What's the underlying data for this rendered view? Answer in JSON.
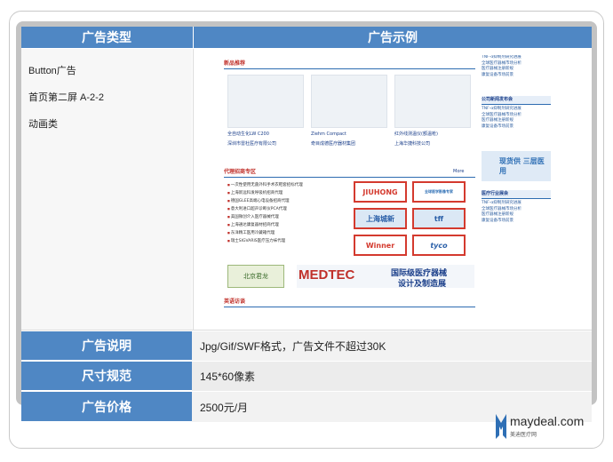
{
  "header": {
    "col1": "广告类型",
    "col2": "广告示例"
  },
  "ad_type_lines": [
    "Button广告",
    "首页第二屏 A-2-2",
    "动画类"
  ],
  "info_rows": [
    {
      "label": "广告说明",
      "value": "Jpg/Gif/SWF格式，广告文件不超过30K"
    },
    {
      "label": "尺寸规范",
      "value": "145*60像素"
    },
    {
      "label": "广告价格",
      "value": "2500元/月"
    }
  ],
  "example": {
    "products_title": "新品推荐",
    "products": [
      {
        "name": "全自动生化LW C200",
        "company": "深圳市雷杜医疗有限公司"
      },
      {
        "name": "Ziehm Compact",
        "company": "奇目成德医疗器材集团"
      },
      {
        "name": "红外线测温仪(额温枪)",
        "company": "上海华捷科技公司"
      }
    ],
    "agents_title": "代理招商专区",
    "more": "More",
    "news": [
      "一次性使用无菌外科手术衣鞋套招标代理",
      "上海新远科发呼吸机招商代理",
      "德国GLEE高端心电设备招商代理",
      "意大利进口超声诊断仪PCA代理",
      "美国微创介入医疗器械代理",
      "上海通达康复器材招商代理",
      "东洋精工医用冷藏箱代理",
      "瑞士SIGVARIS医疗压力袜代理"
    ],
    "logos": [
      "JIUHONG",
      "全球医学影像专家",
      "上海城新",
      "tff",
      "Winner",
      "tyco"
    ],
    "beijing_label": "北京君龙",
    "medtec": "MEDTEC",
    "medtec_cn1": "国际级医疗器械",
    "medtec_cn2": "设计及制造展",
    "bottom_title": "英语访谈",
    "side": {
      "bar1": "公司新闻发布会",
      "banner": "现货供 三层医用",
      "bar2": "医疗行业展会",
      "lines": [
        "TNF-α抑制剂研究进展",
        "全球医疗器械市场分析",
        "医疗器械注册新规",
        "康复设备市场前景"
      ]
    }
  },
  "brand": {
    "name": "maydeal.com",
    "sub": "美迪医疗网"
  }
}
